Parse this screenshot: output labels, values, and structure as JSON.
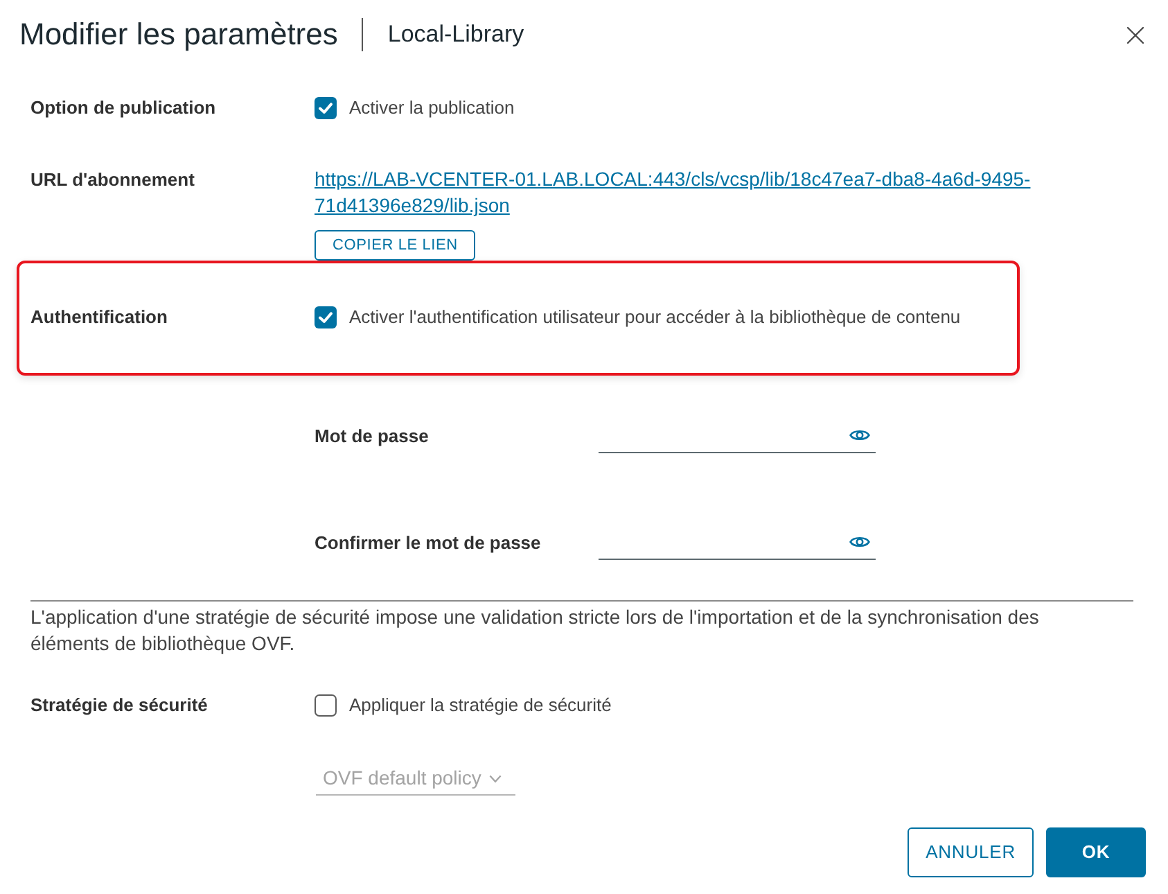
{
  "dialog": {
    "title": "Modifier les paramètres",
    "subtitle": "Local-Library"
  },
  "publication": {
    "label": "Option de publication",
    "checkbox": {
      "label": "Activer la publication",
      "checked": true
    }
  },
  "subscription_url": {
    "label": "URL d'abonnement",
    "link": "https://LAB-VCENTER-01.LAB.LOCAL:443/cls/vcsp/lib/18c47ea7-dba8-4a6d-9495-71d41396e829/lib.json",
    "copy_button": "COPIER LE LIEN"
  },
  "authentication": {
    "label": "Authentification",
    "highlighted": true,
    "checkbox": {
      "label": "Activer l'authentification utilisateur pour accéder à la bibliothèque de contenu",
      "checked": true
    }
  },
  "password_fields": [
    {
      "label": "Mot de passe"
    },
    {
      "label": "Confirmer le mot de passe"
    }
  ],
  "security_note": "L'application d'une stratégie de sécurité impose une validation stricte lors de l'importation et de la synchronisation des éléments de bibliothèque OVF.",
  "security_policy": {
    "label": "Stratégie de sécurité",
    "checkbox": {
      "label": "Appliquer la stratégie de sécurité",
      "checked": false
    },
    "select": {
      "value": "OVF default policy",
      "disabled": true
    }
  },
  "buttons": [
    {
      "label": "ANNULER",
      "kind": "outline"
    },
    {
      "label": "OK",
      "kind": "primary"
    }
  ]
}
